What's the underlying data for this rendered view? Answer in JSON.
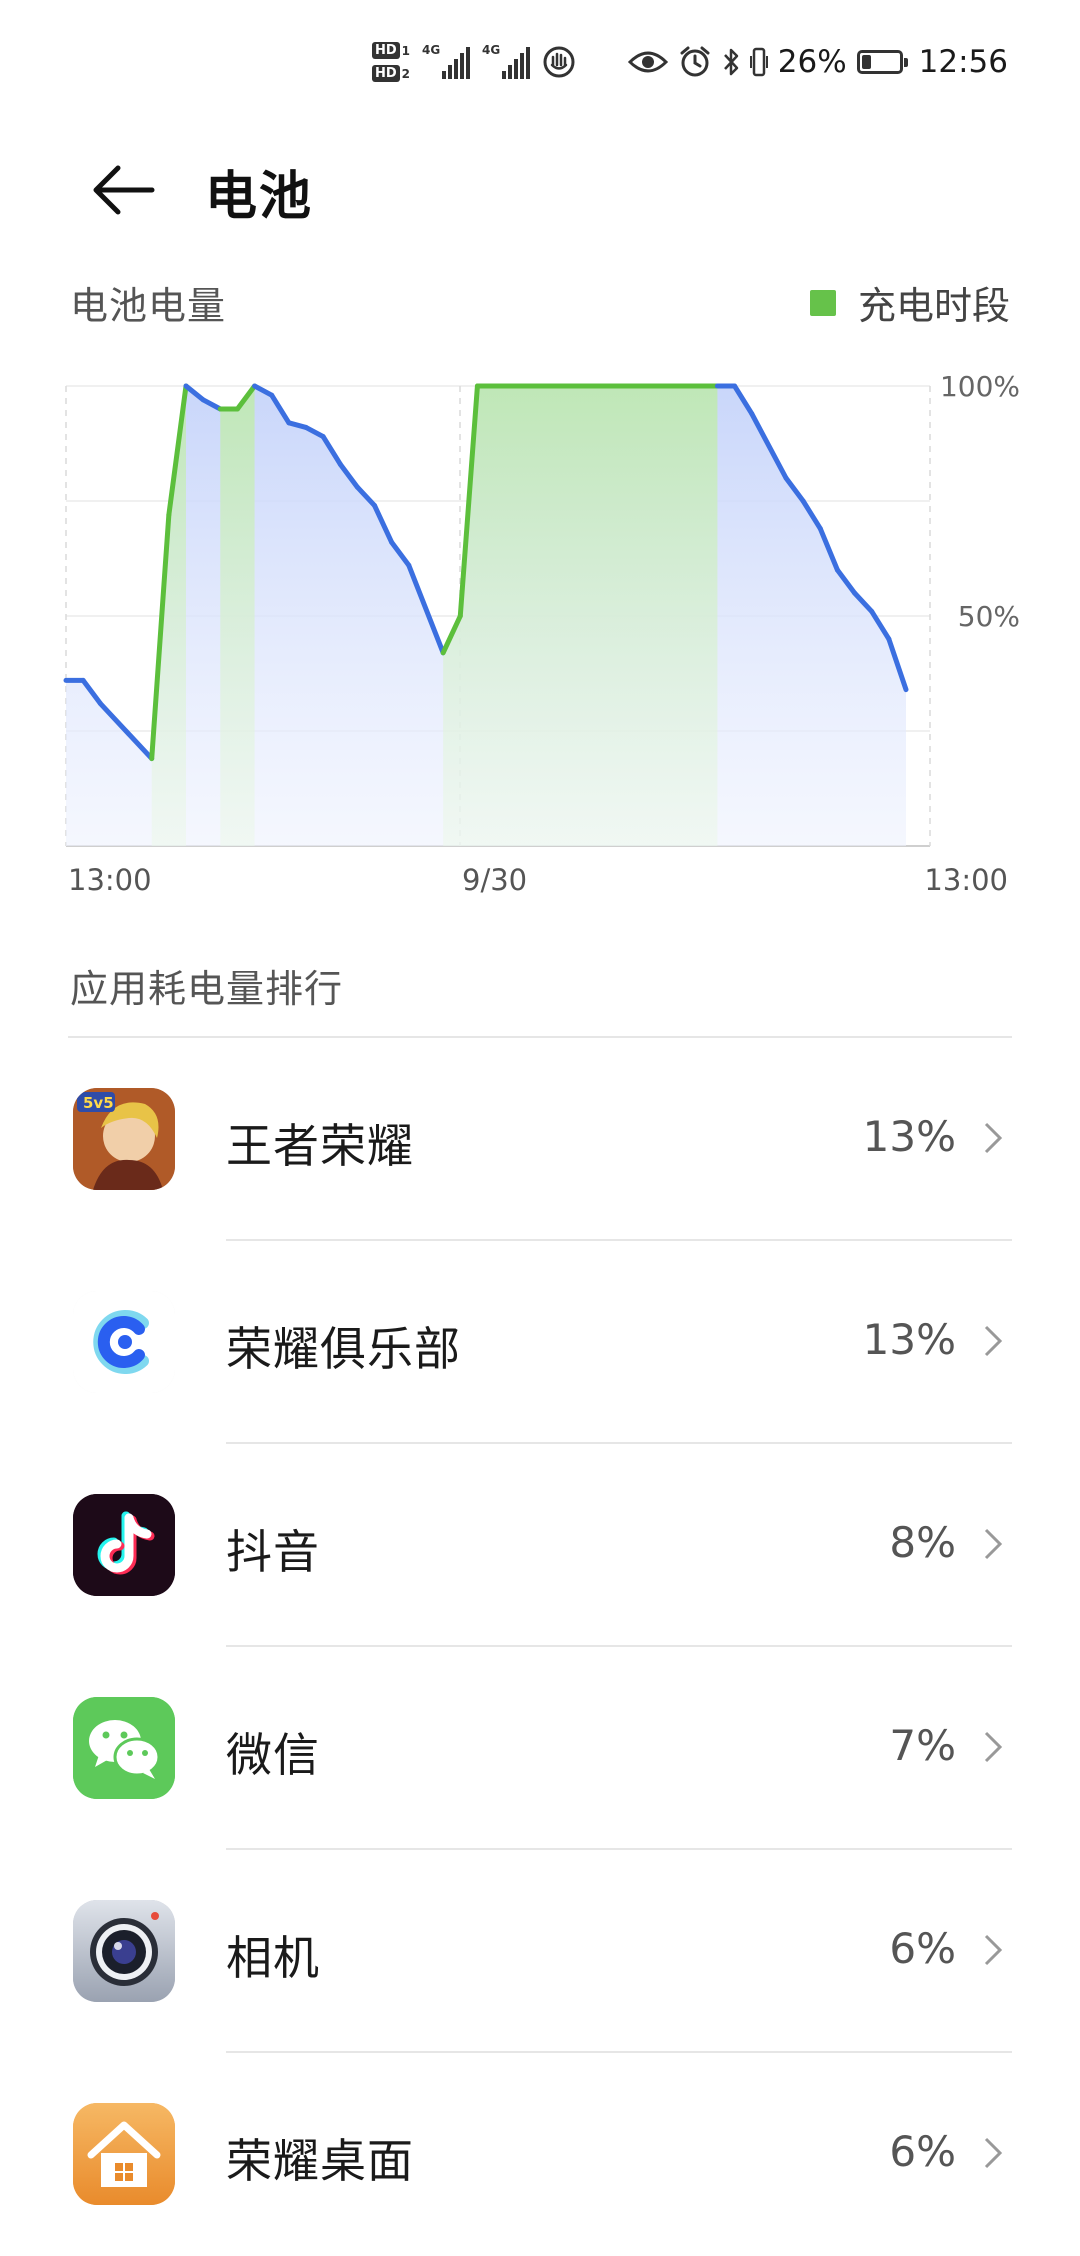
{
  "status_bar": {
    "sim1": "HD",
    "sim1_num": "1",
    "sim2": "HD",
    "sim2_num": "2",
    "net1": "4G",
    "net2": "4G",
    "battery_percent": "26%",
    "battery_level": 0.26,
    "time": "12:56",
    "icons": [
      "hd-sim-icon",
      "signal-icon",
      "signal-icon",
      "hand-icon",
      "eye-icon",
      "alarm-icon",
      "bluetooth-icon",
      "vibrate-icon",
      "battery-icon"
    ]
  },
  "header": {
    "title": "电池",
    "back_icon": "back-arrow-icon"
  },
  "battery_section": {
    "title": "电池电量",
    "legend_label": "充电时段",
    "legend_color": "#66c24a"
  },
  "chart_data": {
    "type": "area",
    "y_unit": "%",
    "ylim": [
      0,
      100
    ],
    "y_ticks": [
      "100%",
      "50%"
    ],
    "x_tick_labels": [
      "13:00",
      "9/30",
      "13:00"
    ],
    "grid": true,
    "line_color_discharge": "#3b6fe0",
    "line_color_charge": "#5cbf3c",
    "points": [
      {
        "t": 0,
        "level": 36
      },
      {
        "t": 3,
        "level": 36
      },
      {
        "t": 6,
        "level": 31
      },
      {
        "t": 15,
        "level": 19
      },
      {
        "t": 18,
        "level": 72
      },
      {
        "t": 21,
        "level": 100
      },
      {
        "t": 24,
        "level": 97
      },
      {
        "t": 27,
        "level": 95
      },
      {
        "t": 30,
        "level": 95
      },
      {
        "t": 33,
        "level": 100
      },
      {
        "t": 36,
        "level": 98
      },
      {
        "t": 39,
        "level": 92
      },
      {
        "t": 42,
        "level": 91
      },
      {
        "t": 45,
        "level": 89
      },
      {
        "t": 48,
        "level": 83
      },
      {
        "t": 51,
        "level": 78
      },
      {
        "t": 54,
        "level": 74
      },
      {
        "t": 57,
        "level": 66
      },
      {
        "t": 60,
        "level": 61
      },
      {
        "t": 66,
        "level": 42
      },
      {
        "t": 69,
        "level": 50
      },
      {
        "t": 72,
        "level": 100
      },
      {
        "t": 114,
        "level": 100
      },
      {
        "t": 117,
        "level": 100
      },
      {
        "t": 120,
        "level": 94
      },
      {
        "t": 126,
        "level": 80
      },
      {
        "t": 129,
        "level": 75
      },
      {
        "t": 132,
        "level": 69
      },
      {
        "t": 135,
        "level": 60
      },
      {
        "t": 138,
        "level": 55
      },
      {
        "t": 141,
        "level": 51
      },
      {
        "t": 144,
        "level": 45
      },
      {
        "t": 147,
        "level": 34
      }
    ],
    "t_range": [
      0,
      147
    ],
    "charging_periods": [
      [
        15,
        21
      ],
      [
        27,
        33
      ],
      [
        66,
        114
      ]
    ]
  },
  "ranking_section": {
    "title": "应用耗电量排行"
  },
  "apps": [
    {
      "name": "王者荣耀",
      "percent": "13%",
      "icon": "game-avatar-icon"
    },
    {
      "name": "荣耀俱乐部",
      "percent": "13%",
      "icon": "honor-club-icon"
    },
    {
      "name": "抖音",
      "percent": "8%",
      "icon": "douyin-icon"
    },
    {
      "name": "微信",
      "percent": "7%",
      "icon": "wechat-icon"
    },
    {
      "name": "相机",
      "percent": "6%",
      "icon": "camera-icon"
    },
    {
      "name": "荣耀桌面",
      "percent": "6%",
      "icon": "home-icon"
    }
  ]
}
